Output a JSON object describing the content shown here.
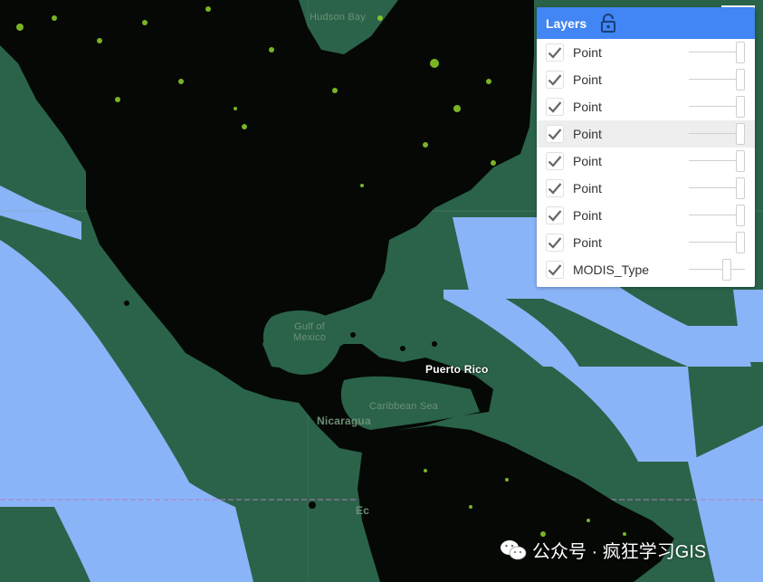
{
  "map": {
    "colors": {
      "ocean": "#8ab4f8",
      "land": "#2a6349",
      "points": "#000000",
      "highlight": "#8fd32a",
      "graticule": "#b07ab8"
    },
    "labels": {
      "hudson_bay": "Hudson Bay",
      "gulf_of_mexico": "Gulf of\nMexico",
      "caribbean_sea": "Caribbean Sea",
      "puerto_rico": "Puerto Rico",
      "nicaragua": "Nicaragua",
      "ecuador_partial": "Ec"
    }
  },
  "layers_panel": {
    "title": "Layers",
    "layers": [
      {
        "name": "Point",
        "checked": true,
        "opacity": 1.0,
        "highlighted": false
      },
      {
        "name": "Point",
        "checked": true,
        "opacity": 1.0,
        "highlighted": false
      },
      {
        "name": "Point",
        "checked": true,
        "opacity": 1.0,
        "highlighted": false
      },
      {
        "name": "Point",
        "checked": true,
        "opacity": 1.0,
        "highlighted": true
      },
      {
        "name": "Point",
        "checked": true,
        "opacity": 1.0,
        "highlighted": false
      },
      {
        "name": "Point",
        "checked": true,
        "opacity": 1.0,
        "highlighted": false
      },
      {
        "name": "Point",
        "checked": true,
        "opacity": 1.0,
        "highlighted": false
      },
      {
        "name": "Point",
        "checked": true,
        "opacity": 1.0,
        "highlighted": false
      },
      {
        "name": "MODIS_Type",
        "checked": true,
        "opacity": 0.72,
        "highlighted": false
      }
    ]
  },
  "watermark": {
    "text": "公众号 · 疯狂学习GIS"
  }
}
